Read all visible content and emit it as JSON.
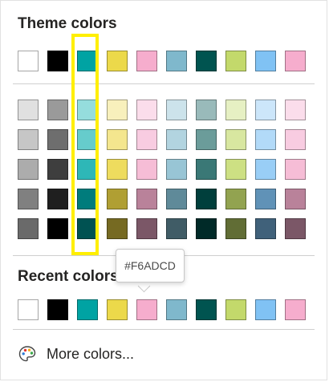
{
  "theme_section": {
    "title": "Theme colors",
    "base_row": [
      "#FFFFFF",
      "#000000",
      "#00A3A3",
      "#ECD94A",
      "#F6ADCD",
      "#7FB8CC",
      "#005450",
      "#C3D96B",
      "#80C2F4",
      "#F6ADCD"
    ],
    "shade_rows": [
      [
        "#E0E0E0",
        "#9A9A9A",
        "#95DDDD",
        "#F8F0BC",
        "#FBDDEB",
        "#CCE3EB",
        "#99BABA",
        "#E6F0C3",
        "#CCE6FA",
        "#FBDDEB"
      ],
      [
        "#C6C6C6",
        "#6E6E6E",
        "#66CCCC",
        "#F4E68E",
        "#F8CCE1",
        "#B2D4E0",
        "#6B9C9A",
        "#D8E7A0",
        "#B2DAF8",
        "#F8CCE1"
      ],
      [
        "#ACACAC",
        "#3E3E3E",
        "#2EB7B7",
        "#EEDC5E",
        "#F6BDD6",
        "#98C5D5",
        "#3A7876",
        "#CDE083",
        "#99CEF6",
        "#F6BDD6"
      ],
      [
        "#808080",
        "#1F1F1F",
        "#007C7C",
        "#B09F33",
        "#B9829A",
        "#5F8A99",
        "#003F3C",
        "#92A350",
        "#6092B7",
        "#B9829A"
      ],
      [
        "#6A6A6A",
        "#000000",
        "#005252",
        "#766A22",
        "#7B5767",
        "#405C66",
        "#002A28",
        "#616D35",
        "#40617A",
        "#7B5767"
      ]
    ]
  },
  "recent_section": {
    "title": "Recent colors",
    "colors": [
      "#FFFFFF",
      "#000000",
      "#00A3A3",
      "#ECD94A",
      "#F6ADCD",
      "#7FB8CC",
      "#005450",
      "#C3D96B",
      "#80C2F4",
      "#F6ADCD"
    ]
  },
  "tooltip": {
    "text": "#F6ADCD"
  },
  "more_colors": {
    "label": "More colors...",
    "icon": "palette-icon"
  },
  "highlight_color": "#FFEF00"
}
